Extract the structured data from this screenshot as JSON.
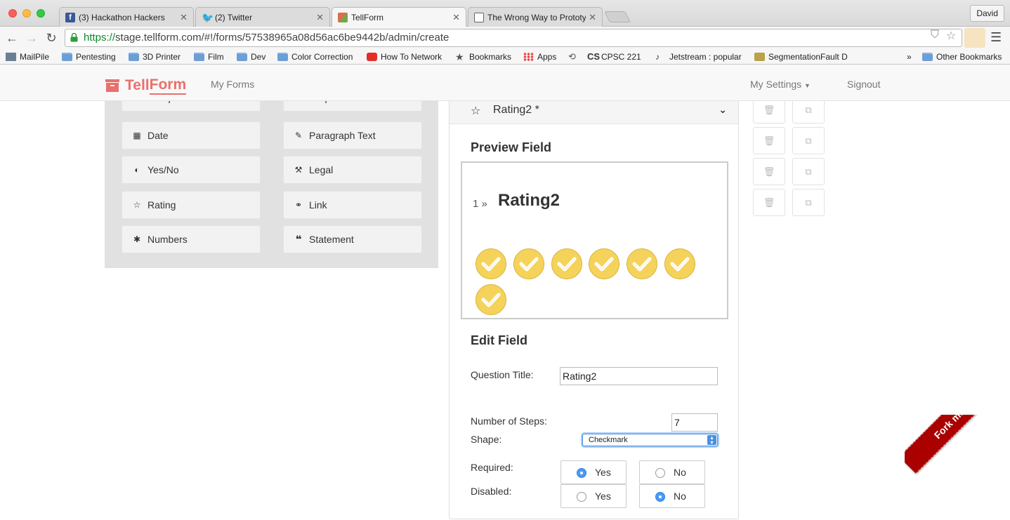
{
  "browser": {
    "profile": "David",
    "tabs": [
      {
        "label": "(3) Hackathon Hackers",
        "favicon": "facebook-icon"
      },
      {
        "label": "(2) Twitter",
        "favicon": "twitter-icon"
      },
      {
        "label": "TellForm",
        "favicon": "tellform-icon"
      },
      {
        "label": "The Wrong Way to Prototyp",
        "favicon": "page-icon"
      }
    ],
    "url_protocol": "https://",
    "url_rest": "stage.tellform.com/#!/forms/57538965a08d56ac6be9442b/admin/create",
    "bookmarks": [
      {
        "label": "MailPile",
        "icon": "mail-icon"
      },
      {
        "label": "Pentesting",
        "icon": "folder-icon"
      },
      {
        "label": "3D Printer",
        "icon": "folder-icon"
      },
      {
        "label": "Film",
        "icon": "folder-icon"
      },
      {
        "label": "Dev",
        "icon": "folder-icon"
      },
      {
        "label": "Color Correction",
        "icon": "folder-icon"
      },
      {
        "label": "How To Network",
        "icon": "youtube-icon"
      },
      {
        "label": "Bookmarks",
        "icon": "star-icon"
      },
      {
        "label": "Apps",
        "icon": "apps-grid-icon"
      },
      {
        "label": "",
        "icon": "history-icon"
      },
      {
        "label": "CPSC 221",
        "icon": "cs-logo-icon"
      },
      {
        "label": "Jetstream : popular",
        "icon": "music-note-icon"
      },
      {
        "label": "SegmentationFault D",
        "icon": "bug-icon"
      }
    ],
    "overflow": "»",
    "other_bookmarks": "Other Bookmarks"
  },
  "app": {
    "logo": {
      "part1": "Tell",
      "part2": "Form"
    },
    "nav_myforms": "My Forms",
    "nav_settings": "My Settings",
    "nav_signout": "Signout"
  },
  "add_fields": [
    {
      "label": "Multiple Choice",
      "icon": "circle-icon"
    },
    {
      "label": "Dropdown",
      "icon": "list-icon"
    },
    {
      "label": "Date",
      "icon": "calendar-icon"
    },
    {
      "label": "Paragraph Text",
      "icon": "edit-icon"
    },
    {
      "label": "Yes/No",
      "icon": "toggle-icon"
    },
    {
      "label": "Legal",
      "icon": "gavel-icon"
    },
    {
      "label": "Rating",
      "icon": "star-half-icon"
    },
    {
      "label": "Link",
      "icon": "link-icon"
    },
    {
      "label": "Numbers",
      "icon": "asterisk-icon"
    },
    {
      "label": "Statement",
      "icon": "quote-icon"
    }
  ],
  "field": {
    "header_title": "Rating2 *",
    "preview_heading": "Preview Field",
    "question_number": "1",
    "question_arrow": "»",
    "question_title": "Rating2",
    "rating_count": 7,
    "rating_color": "#f5d35b",
    "edit_heading": "Edit Field",
    "question_title_label": "Question Title:",
    "question_title_value": "Rating2",
    "steps_label": "Number of Steps:",
    "steps_value": "7",
    "shape_label": "Shape:",
    "shape_value": "Checkmark",
    "required_label": "Required:",
    "disabled_label": "Disabled:",
    "yes": "Yes",
    "no": "No",
    "required": "Yes",
    "disabled": "No"
  },
  "ribbon": "Fork me on GitHub",
  "colors": {
    "brand": "#e9706c",
    "ribbon": "#aa0000",
    "radio_on": "#2f86e6"
  }
}
